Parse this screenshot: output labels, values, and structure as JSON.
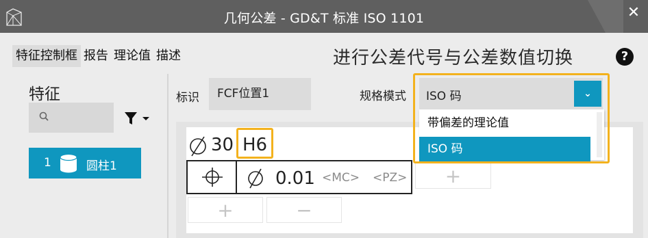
{
  "window": {
    "title": "几何公差 - GD&T 标准 ISO 1101"
  },
  "tabs": [
    {
      "label": "特征控制框",
      "active": true
    },
    {
      "label": "报告"
    },
    {
      "label": "理论值"
    },
    {
      "label": "描述"
    }
  ],
  "heading": "进行公差代号与公差数值切换",
  "help_icon": "?",
  "features": {
    "title": "特征",
    "search_placeholder": "",
    "items": [
      {
        "number": "1",
        "icon": "cylinder-icon",
        "name": "圆柱1",
        "selected": true
      }
    ]
  },
  "identifier": {
    "label": "标识",
    "value": "FCF位置1"
  },
  "spec_mode": {
    "label": "规格模式",
    "value": "ISO 码",
    "options": [
      "带偏差的理论值",
      "ISO 码"
    ],
    "selected_index": 1,
    "expanded": true
  },
  "fcf": {
    "dimension_value": "30",
    "fit_code": "H6",
    "tolerance_value": "0.01",
    "modifier_mc": "<MC>",
    "modifier_pz": "<PZ>",
    "add_label": "+",
    "remove_label": "−"
  },
  "colors": {
    "accent": "#0f97bf",
    "highlight": "#f3b21d",
    "titlebar": "#5f5f5f"
  }
}
